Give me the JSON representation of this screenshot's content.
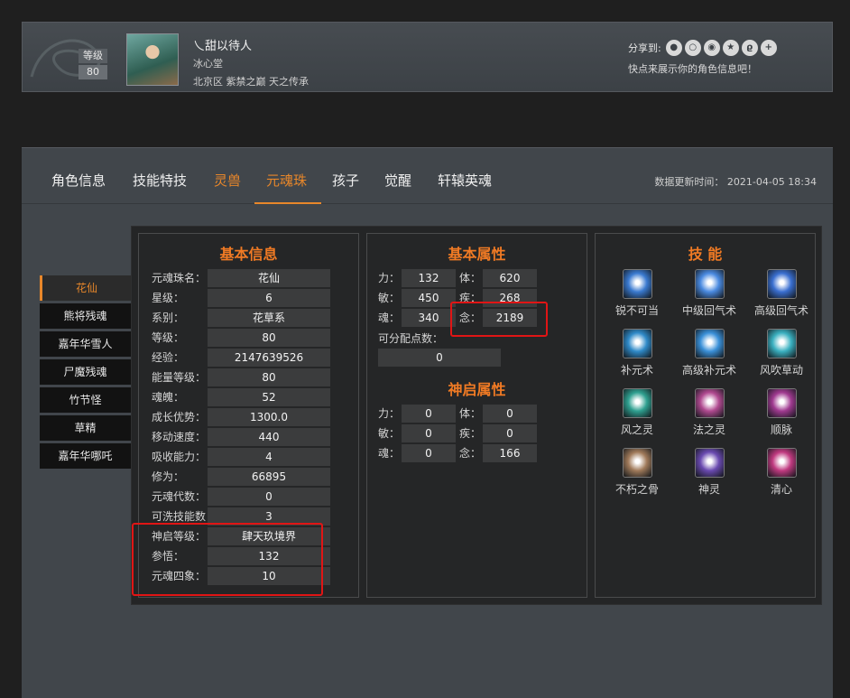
{
  "profile": {
    "level_label": "等级",
    "level_value": "80",
    "name": "乀甜以待人",
    "guild": "冰心堂",
    "server": "北京区 紫禁之巅 天之传承",
    "share_label": "分享到:",
    "share_icons": [
      "wechat-icon",
      "qzone-icon",
      "weibo-icon",
      "star-icon",
      "renren-icon",
      "plus-icon"
    ],
    "share_tip": "快点来展示你的角色信息吧！"
  },
  "tabs": [
    "角色信息",
    "技能特技",
    "灵兽",
    "元魂珠",
    "孩子",
    "觉醒",
    "轩辕英魂"
  ],
  "active_tab": "元魂珠",
  "update_time": "数据更新时间： 2021-04-05 18:34",
  "sidebar": [
    "花仙",
    "熊将残魂",
    "嘉年华雪人",
    "尸魔残魂",
    "竹节怪",
    "草精",
    "嘉年华哪吒"
  ],
  "basic_info": {
    "title": "基本信息",
    "rows": [
      {
        "k": "元魂珠名：",
        "v": "花仙"
      },
      {
        "k": "星级：",
        "v": "6"
      },
      {
        "k": "系别：",
        "v": "花草系"
      },
      {
        "k": "等级：",
        "v": "80"
      },
      {
        "k": "经验：",
        "v": "2147639526"
      },
      {
        "k": "能量等级：",
        "v": "80"
      },
      {
        "k": "魂魄：",
        "v": "52"
      },
      {
        "k": "成长优势：",
        "v": "1300.0"
      },
      {
        "k": "移动速度：",
        "v": "440"
      },
      {
        "k": "吸收能力：",
        "v": "4"
      },
      {
        "k": "修为：",
        "v": "66895"
      },
      {
        "k": "元魂代数：",
        "v": "0"
      },
      {
        "k": "可洗技能数：",
        "v": "3"
      },
      {
        "k": "神启等级：",
        "v": "肆天玖境界"
      },
      {
        "k": "参悟：",
        "v": "132"
      },
      {
        "k": "元魂四象：",
        "v": "10"
      }
    ]
  },
  "basic_attr": {
    "title": "基本属性",
    "rows": [
      {
        "k1": "力：",
        "v1": "132",
        "k2": "体：",
        "v2": "620"
      },
      {
        "k1": "敏：",
        "v1": "450",
        "k2": "疾：",
        "v2": "268"
      },
      {
        "k1": "魂：",
        "v1": "340",
        "k2": "念：",
        "v2": "2189"
      }
    ],
    "free_label": "可分配点数：",
    "free_value": "0"
  },
  "shenqi_attr": {
    "title": "神启属性",
    "rows": [
      {
        "k1": "力：",
        "v1": "0",
        "k2": "体：",
        "v2": "0"
      },
      {
        "k1": "敏：",
        "v1": "0",
        "k2": "疾：",
        "v2": "0"
      },
      {
        "k1": "魂：",
        "v1": "0",
        "k2": "念：",
        "v2": "166"
      }
    ]
  },
  "skills": {
    "title": "技 能",
    "items": [
      {
        "name": "锐不可当",
        "icon": "blade-icon",
        "color": "#3a7ad0"
      },
      {
        "name": "中级回气术",
        "icon": "swirl-icon",
        "color": "#4a8ae0"
      },
      {
        "name": "高级回气术",
        "icon": "swirl-icon",
        "color": "#3a6fd0"
      },
      {
        "name": "补元术",
        "icon": "water-icon",
        "color": "#2f8ac8"
      },
      {
        "name": "高级补元术",
        "icon": "water-icon",
        "color": "#3a90d8"
      },
      {
        "name": "风吹草动",
        "icon": "wind-icon",
        "color": "#3ab0c0"
      },
      {
        "name": "风之灵",
        "icon": "spiral-icon",
        "color": "#2fa090"
      },
      {
        "name": "法之灵",
        "icon": "star-rune-icon",
        "color": "#b04a90"
      },
      {
        "name": "顺脉",
        "icon": "orb-icon",
        "color": "#a03a90"
      },
      {
        "name": "不朽之骨",
        "icon": "bone-icon",
        "color": "#a07a5a"
      },
      {
        "name": "神灵",
        "icon": "shield-icon",
        "color": "#6a4ab0"
      },
      {
        "name": "清心",
        "icon": "lotus-icon",
        "color": "#c03a80"
      }
    ]
  }
}
